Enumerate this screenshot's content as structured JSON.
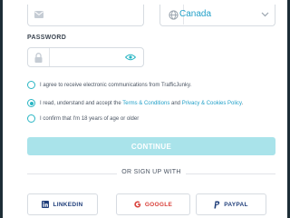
{
  "form": {
    "email": {
      "value": "",
      "icon": "envelope-icon"
    },
    "country": {
      "value": "Canada",
      "icon": "globe-icon"
    },
    "password": {
      "label": "PASSWORD",
      "value": "",
      "icon": "lock-icon"
    }
  },
  "consents": [
    {
      "text": "I agree to receive electronic communications from TrafficJunky.",
      "checked": false
    },
    {
      "text_before": "I read, understand and accept the ",
      "link1": "Terms & Conditions",
      "text_mid": " and ",
      "link2": "Privacy & Cookies Policy",
      "text_after": ".",
      "checked": true
    },
    {
      "text": "I confirm that I'm 18 years of age or older",
      "checked": false
    }
  ],
  "continue_label": "CONTINUE",
  "divider_text": "OR SIGN UP WITH",
  "social": {
    "linkedin": "LINKEDIN",
    "google": "GOOGLE",
    "paypal": "PAYPAL"
  },
  "colors": {
    "accent": "#2ab6c4",
    "link": "#22a0c8",
    "continue_bg": "#a9e3ea",
    "page_edge": "#1d2d36"
  }
}
